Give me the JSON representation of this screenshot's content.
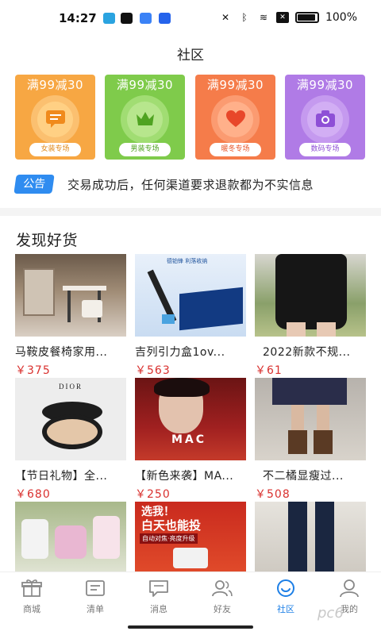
{
  "status_bar": {
    "time": "14:27",
    "battery": "100%",
    "icons": [
      "telegram-icon",
      "tiktok-icon",
      "app-icon",
      "app-icon",
      "mute-icon",
      "bluetooth-icon",
      "wifi-icon",
      "sim-icon",
      "battery-icon"
    ]
  },
  "header": {
    "title": "社区"
  },
  "promos": [
    {
      "title": "满99减30",
      "label": "女装专场",
      "icon": "message-icon",
      "color": "#f7a743"
    },
    {
      "title": "满99减30",
      "label": "男装专场",
      "icon": "crown-icon",
      "color": "#7fcb4b"
    },
    {
      "title": "满99减30",
      "label": "暖冬专场",
      "icon": "heart-icon",
      "color": "#f57c4a"
    },
    {
      "title": "满99减30",
      "label": "数码专场",
      "icon": "camera-icon",
      "color": "#b07be6"
    }
  ],
  "notice": {
    "tag": "公告",
    "text": "交易成功后，任何渠道要求退款都为不实信息"
  },
  "section": {
    "title": "发现好货"
  },
  "products": [
    {
      "name": "马鞍皮餐椅家用...",
      "price": "￥375"
    },
    {
      "name": "吉列引力盒1ov...",
      "price": "￥563"
    },
    {
      "name": "2022新款不规...",
      "price": "￥61"
    },
    {
      "name": "【节日礼物】全...",
      "price": "￥680"
    },
    {
      "name": "【新色来袭】MA...",
      "price": "￥250"
    },
    {
      "name": "不二橘显瘦过...",
      "price": "￥508"
    },
    {
      "name": "",
      "price": ""
    },
    {
      "name": "选我！白天也能投",
      "price": ""
    },
    {
      "name": "",
      "price": ""
    }
  ],
  "product_image_text": {
    "p2_banner": "德铂锋 利落收纳",
    "p4_brand": "DIOR",
    "p5_brand": "MAC",
    "p8_line1": "选我！",
    "p8_line2": "白天也能投",
    "p8_tag": "自动对焦·亮度升级"
  },
  "tabbar": [
    {
      "label": "商城",
      "icon": "gift-icon"
    },
    {
      "label": "清单",
      "icon": "list-icon"
    },
    {
      "label": "消息",
      "icon": "chat-icon"
    },
    {
      "label": "好友",
      "icon": "friends-icon"
    },
    {
      "label": "社区",
      "icon": "community-icon",
      "active": true
    },
    {
      "label": "我的",
      "icon": "profile-icon"
    }
  ],
  "watermark": "pc6"
}
